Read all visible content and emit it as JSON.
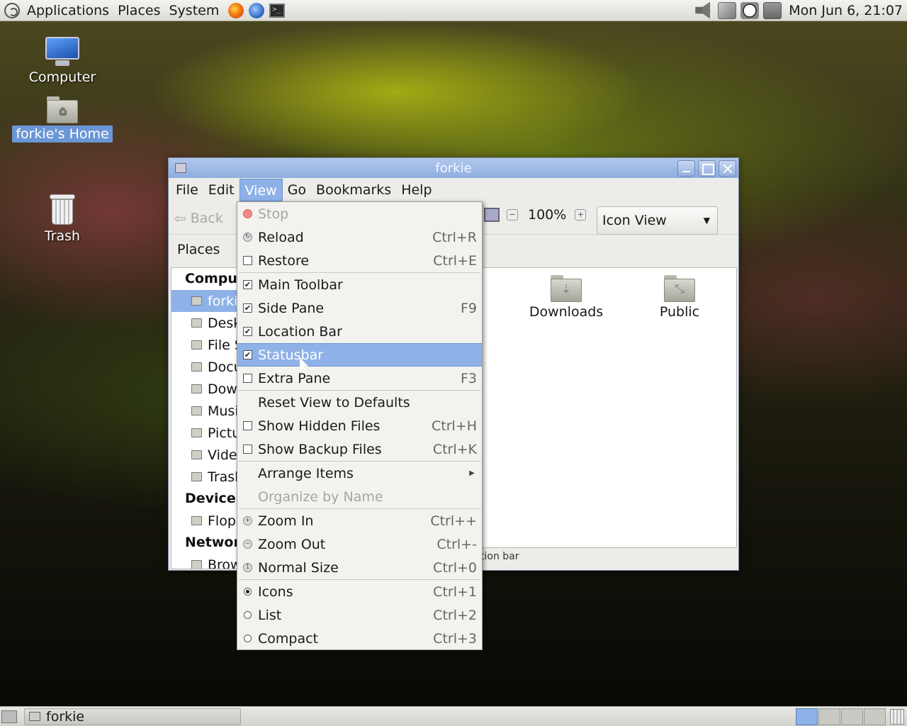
{
  "top_panel": {
    "menus": [
      "Applications",
      "Places",
      "System"
    ],
    "clock": "Mon Jun  6, 21:07"
  },
  "desktop": {
    "icons": [
      {
        "label": "Computer",
        "icon": "computer-icon"
      },
      {
        "label": "forkie's Home",
        "icon": "home-folder-icon",
        "selected": true
      },
      {
        "label": "Trash",
        "icon": "trash-icon"
      }
    ]
  },
  "window": {
    "title": "forkie",
    "menubar": [
      "File",
      "Edit",
      "View",
      "Go",
      "Bookmarks",
      "Help"
    ],
    "toolbar": {
      "back_label": "Back",
      "zoom": "100%",
      "view_mode": "Icon View"
    },
    "places_label": "Places",
    "sidebar": {
      "sections": [
        {
          "heading": "Compu",
          "items": [
            "forki",
            "Desk",
            "File S",
            "Docu",
            "Dow",
            "Musi",
            "Pictu",
            "Vide",
            "Trasl"
          ]
        },
        {
          "heading": "Device",
          "items": [
            "Flop"
          ]
        },
        {
          "heading": "Networ",
          "items": [
            "Brow"
          ]
        }
      ]
    },
    "files": [
      {
        "label": "s"
      },
      {
        "label": "Downloads"
      },
      {
        "label": "Public"
      }
    ],
    "statusbar": "tion bar"
  },
  "view_menu": {
    "items": [
      {
        "label": "Stop",
        "accel": "",
        "kind": "icon",
        "disabled": true
      },
      {
        "label": "Reload",
        "accel": "Ctrl+R",
        "kind": "icon"
      },
      {
        "label": "Restore",
        "accel": "Ctrl+E",
        "kind": "check",
        "checked": false
      },
      {
        "sep": true
      },
      {
        "label": "Main Toolbar",
        "accel": "",
        "kind": "check",
        "checked": true
      },
      {
        "label": "Side Pane",
        "accel": "F9",
        "kind": "check",
        "checked": true
      },
      {
        "label": "Location Bar",
        "accel": "",
        "kind": "check",
        "checked": true
      },
      {
        "label": "Statusbar",
        "accel": "",
        "kind": "check",
        "checked": true,
        "highlighted": true
      },
      {
        "label": "Extra Pane",
        "accel": "F3",
        "kind": "check",
        "checked": false
      },
      {
        "sep": true
      },
      {
        "label": "Reset View to Defaults",
        "accel": "",
        "kind": "none"
      },
      {
        "label": "Show Hidden Files",
        "accel": "Ctrl+H",
        "kind": "check",
        "checked": false
      },
      {
        "label": "Show Backup Files",
        "accel": "Ctrl+K",
        "kind": "check",
        "checked": false
      },
      {
        "sep": true
      },
      {
        "label": "Arrange Items",
        "accel": "",
        "kind": "none",
        "submenu": true
      },
      {
        "label": "Organize by Name",
        "accel": "",
        "kind": "none",
        "disabled": true
      },
      {
        "sep": true
      },
      {
        "label": "Zoom In",
        "accel": "Ctrl++",
        "kind": "icon"
      },
      {
        "label": "Zoom Out",
        "accel": "Ctrl+-",
        "kind": "icon"
      },
      {
        "label": "Normal Size",
        "accel": "Ctrl+0",
        "kind": "icon"
      },
      {
        "sep": true
      },
      {
        "label": "Icons",
        "accel": "Ctrl+1",
        "kind": "radio",
        "checked": true
      },
      {
        "label": "List",
        "accel": "Ctrl+2",
        "kind": "radio",
        "checked": false
      },
      {
        "label": "Compact",
        "accel": "Ctrl+3",
        "kind": "radio",
        "checked": false
      }
    ]
  },
  "taskbar": {
    "tasks": [
      {
        "label": "forkie"
      }
    ]
  }
}
